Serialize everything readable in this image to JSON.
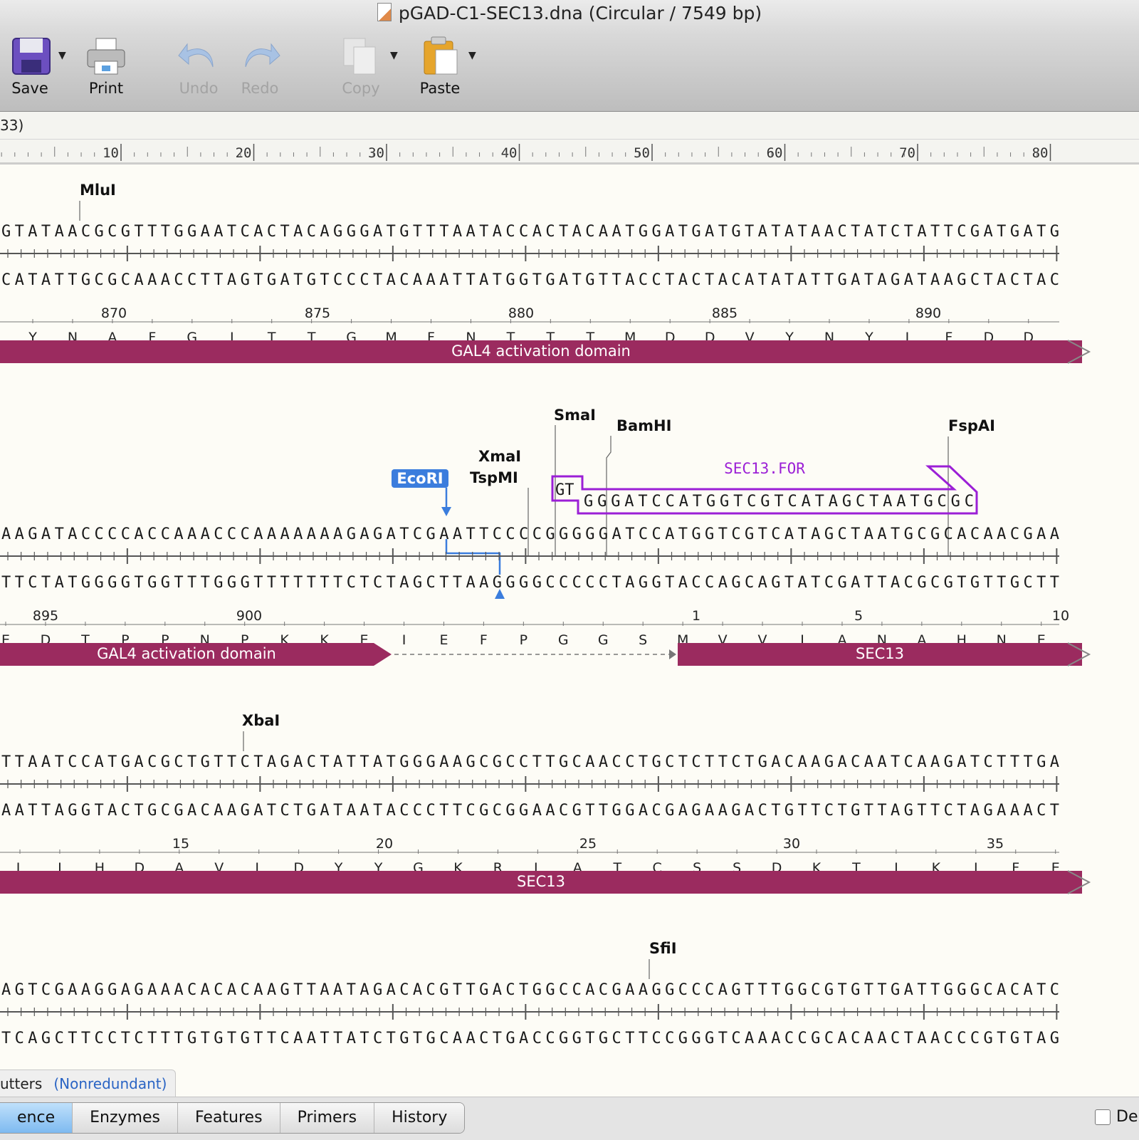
{
  "window": {
    "title": "pGAD-C1-SEC13.dna  (Circular / 7549 bp)"
  },
  "toolbar": {
    "save": "Save",
    "print": "Print",
    "undo": "Undo",
    "redo": "Redo",
    "copy": "Copy",
    "paste": "Paste"
  },
  "infobar": {
    "text": "33)"
  },
  "ruler": {
    "labels": [
      "10",
      "20",
      "30",
      "40",
      "50",
      "60",
      "70",
      "80"
    ]
  },
  "blocks": [
    {
      "sites": [
        "MluI"
      ],
      "top": "GTATAACGCGTTTGGAATCACTACAGGGATGTTTAATACCACTACAATGGATGATGTATATAACTATCTATTCGATGATG",
      "bottom": "CATATTGCGCAAACCTTAGTGATGTCCCTACAAATTATGGTGATGTTACCTACTACATATATTGATAGATAAGCTACTAC",
      "aa_numbers": [
        "870",
        "875",
        "880",
        "885",
        "890"
      ],
      "aa": [
        "Y",
        "N",
        "A",
        "F",
        "G",
        "I",
        "T",
        "T",
        "G",
        "M",
        "F",
        "N",
        "T",
        "T",
        "T",
        "M",
        "D",
        "D",
        "V",
        "Y",
        "N",
        "Y",
        "L",
        "F",
        "D",
        "D"
      ],
      "feature": "GAL4 activation domain"
    },
    {
      "sites": [
        "SmaI",
        "BamHI",
        "FspAI",
        "XmaI",
        "TspMI",
        "EcoRI"
      ],
      "primer": {
        "name": "SEC13.FOR",
        "tail": "GT",
        "seq": "GGGATCCATGGTCGTCATAGCTAATGCGC",
        "color": "#9b1fd6"
      },
      "top": "AAGATACCCCACCAAACCCAAAAAAAGAGATCGAATTCCCCGGGGGATCCATGGTCGTCATAGCTAATGCGCACAACGAA",
      "bottom": "TTCTATGGGGTGGTTTGGGTTTTTTTCTCTAGCTTAAGGGGCCCCCTAGGTACCAGCAGTATCGATTACGCGTGTTGCTT",
      "aa_numbers": [
        "895",
        "900",
        "1",
        "5",
        "10"
      ],
      "aa": [
        "E",
        "D",
        "T",
        "P",
        "P",
        "N",
        "P",
        "K",
        "K",
        "E",
        "I",
        "E",
        "F",
        "P",
        "G",
        "G",
        "S",
        "M",
        "V",
        "V",
        "I",
        "A",
        "N",
        "A",
        "H",
        "N",
        "E"
      ],
      "feature_left": "GAL4 activation domain",
      "feature_right": "SEC13"
    },
    {
      "sites": [
        "XbaI"
      ],
      "top": "TTAATCCATGACGCTGTTCTAGACTATTATGGGAAGCGCCTTGCAACCTGCTCTTCTGACAAGACAATCAAGATCTTTGA",
      "bottom": "AATTAGGTACTGCGACAAGATCTGATAATACCCTTCGCGGAACGTTGGACGAGAAGACTGTTCTGTTAGTTCTAGAAACT",
      "aa_numbers": [
        "15",
        "20",
        "25",
        "30",
        "35"
      ],
      "aa": [
        "L",
        "I",
        "H",
        "D",
        "A",
        "V",
        "L",
        "D",
        "Y",
        "Y",
        "G",
        "K",
        "R",
        "L",
        "A",
        "T",
        "C",
        "S",
        "S",
        "D",
        "K",
        "T",
        "I",
        "K",
        "I",
        "F",
        "E"
      ],
      "feature": "SEC13"
    },
    {
      "sites": [
        "SfiI"
      ],
      "top": "AGTCGAAGGAGAAACACACAAGTTAATAGACACGTTGACTGGCCACGAAGGCCCAGTTTGGCGTGTTGATTGGGCACATC",
      "bottom": "TCAGCTTCCTCTTTGTGTGTTCAATTATCTGTGCAACTGACCGGTGCTTCCGGGTCAAACCGCACAACTAACCCGTGTAG"
    }
  ],
  "status": {
    "cutters": "utters",
    "nonredundant": "(Nonredundant)"
  },
  "tabs": [
    "ence",
    "Enzymes",
    "Features",
    "Primers",
    "History"
  ],
  "detach_label": "De",
  "colors": {
    "feature": "#9b2b5f",
    "enzyme_box": "#3b7ddd",
    "primer": "#9b1fd6"
  }
}
